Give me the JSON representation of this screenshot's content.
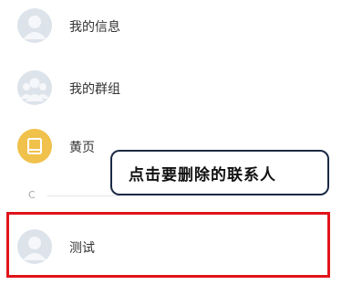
{
  "contacts_menu": {
    "items": [
      {
        "label": "我的信息",
        "icon": "person-avatar-icon"
      },
      {
        "label": "我的群组",
        "icon": "group-avatar-icon"
      },
      {
        "label": "黄页",
        "icon": "book-icon"
      }
    ]
  },
  "section": {
    "letter": "C"
  },
  "contact": {
    "label": "测试",
    "icon": "person-avatar-icon"
  },
  "annotation": {
    "text": "点击要删除的联系人"
  },
  "colors": {
    "avatar_bg": "#dde3ea",
    "yellow_page_bg": "#f0c14b",
    "highlight_border": "#e0141a",
    "callout_border": "#1b2a44"
  }
}
